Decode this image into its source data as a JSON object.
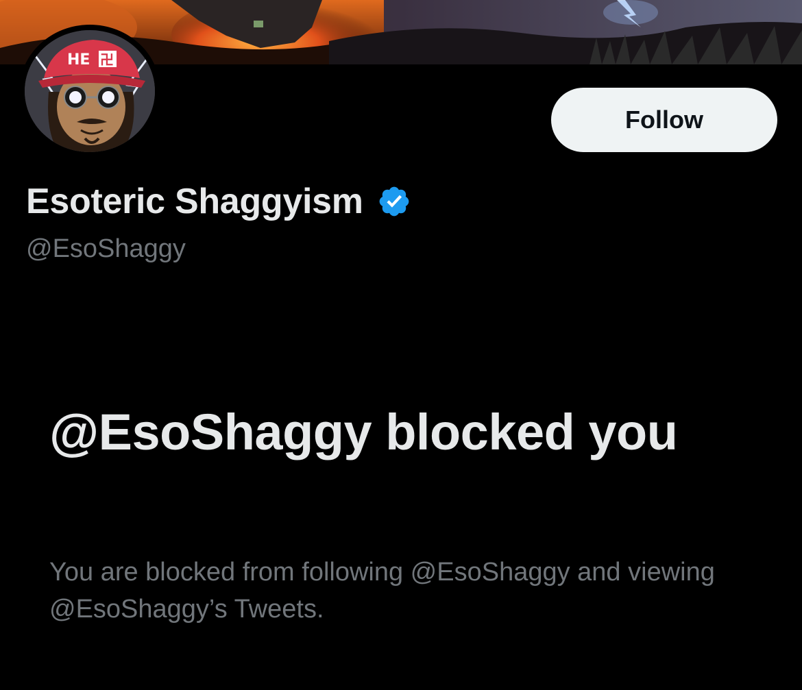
{
  "profile": {
    "display_name": "Esoteric Shaggyism",
    "handle": "@EsoShaggy",
    "verified": true,
    "avatar_cap_text": "HE",
    "avatar_cap_text_2": "卍"
  },
  "actions": {
    "follow_label": "Follow"
  },
  "blocked_notice": {
    "heading": "@EsoShaggy blocked you",
    "description": "You are blocked from following @EsoShaggy and viewing @EsoShaggy’s Tweets."
  },
  "icons": {
    "verified": "verified-badge-icon"
  },
  "colors": {
    "background": "#000000",
    "primary_text": "#e7e9ea",
    "secondary_text": "#71767b",
    "verified_blue": "#1d9bf0",
    "follow_button_bg": "#eff3f4"
  }
}
